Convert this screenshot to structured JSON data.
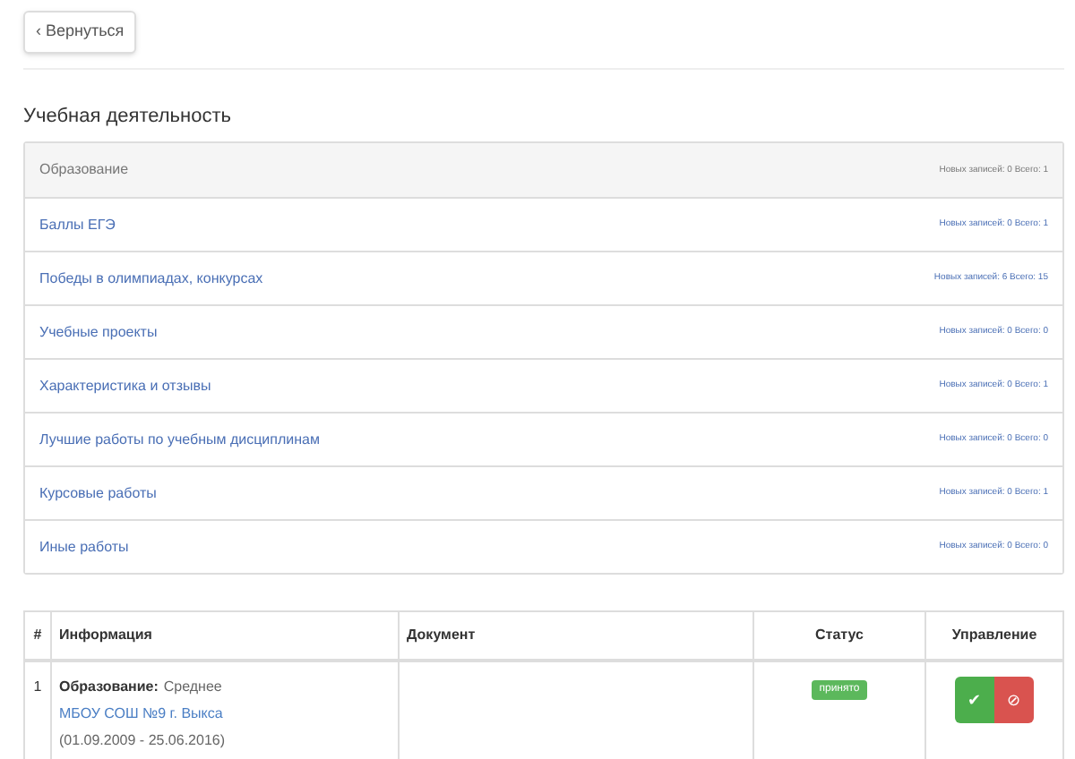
{
  "back_button": {
    "label": "‹ Вернуться"
  },
  "section_title": "Учебная деятельность",
  "categories": [
    {
      "label": "Образование",
      "selected": true,
      "counts": "Новых записей: 0 Всего: 1"
    },
    {
      "label": "Баллы ЕГЭ",
      "selected": false,
      "counts": "Новых записей: 0 Всего: 1"
    },
    {
      "label": "Победы в олимпиадах, конкурсах",
      "selected": false,
      "counts": "Новых записей: 6 Всего: 15"
    },
    {
      "label": "Учебные проекты",
      "selected": false,
      "counts": "Новых записей: 0 Всего: 0"
    },
    {
      "label": "Характеристика и отзывы",
      "selected": false,
      "counts": "Новых записей: 0 Всего: 1"
    },
    {
      "label": "Лучшие работы по учебным дисциплинам",
      "selected": false,
      "counts": "Новых записей: 0 Всего: 0"
    },
    {
      "label": "Курсовые работы",
      "selected": false,
      "counts": "Новых записей: 0 Всего: 1"
    },
    {
      "label": "Иные работы",
      "selected": false,
      "counts": "Новых записей: 0 Всего: 0"
    }
  ],
  "table": {
    "columns": [
      "#",
      "Информация",
      "Документ",
      "Статус",
      "Управление"
    ],
    "rows": [
      {
        "number": "1",
        "info_label": "Образование:",
        "info_value": "Среднее",
        "school": "МБОУ СОШ №9 г. Выкса",
        "period": "(01.09.2009 - 25.06.2016)",
        "status": {
          "label": "принято",
          "color": "#5cb85c"
        },
        "actions": [
          "✔",
          "⊘"
        ]
      }
    ]
  }
}
